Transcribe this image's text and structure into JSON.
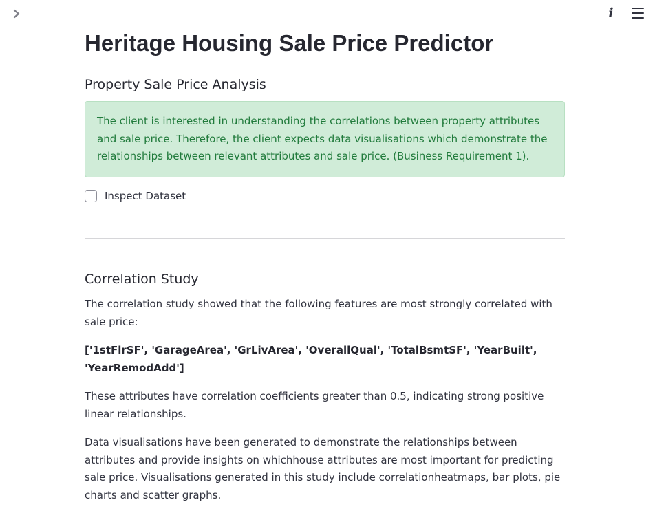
{
  "header": {
    "sidebar_toggle_icon": "chevron-right-icon",
    "info_glyph": "i",
    "menu_icon": "hamburger-menu-icon"
  },
  "page": {
    "title": "Heritage Housing Sale Price Predictor",
    "subheading": "Property Sale Price Analysis",
    "alert_text": "The client is interested in understanding the correlations between property attributes and sale price. Therefore, the client expects data visualisations which demonstrate the relationships between relevant attributes and sale price. (Business Requirement 1).",
    "alert_color": "#d0ecd8",
    "checkbox_label": "Inspect Dataset",
    "checkbox_checked": false
  },
  "correlation": {
    "title": "Correlation Study",
    "intro": "The correlation study showed that the following features are most strongly correlated with sale price:",
    "features": "['1stFlrSF', 'GarageArea', 'GrLivArea', 'OverallQual', 'TotalBsmtSF', 'YearBuilt', 'YearRemodAdd']",
    "coefficients": "These attributes have correlation coefficients greater than 0.5, indicating strong positive linear relationships.",
    "visualisations": "Data visualisations have been generated to demonstrate the relationships between attributes and provide insights on whichhouse attributes are most important for predicting sale price. Visualisations generated in this study include correlationheatmaps, bar plots, pie charts and scatter graphs."
  }
}
